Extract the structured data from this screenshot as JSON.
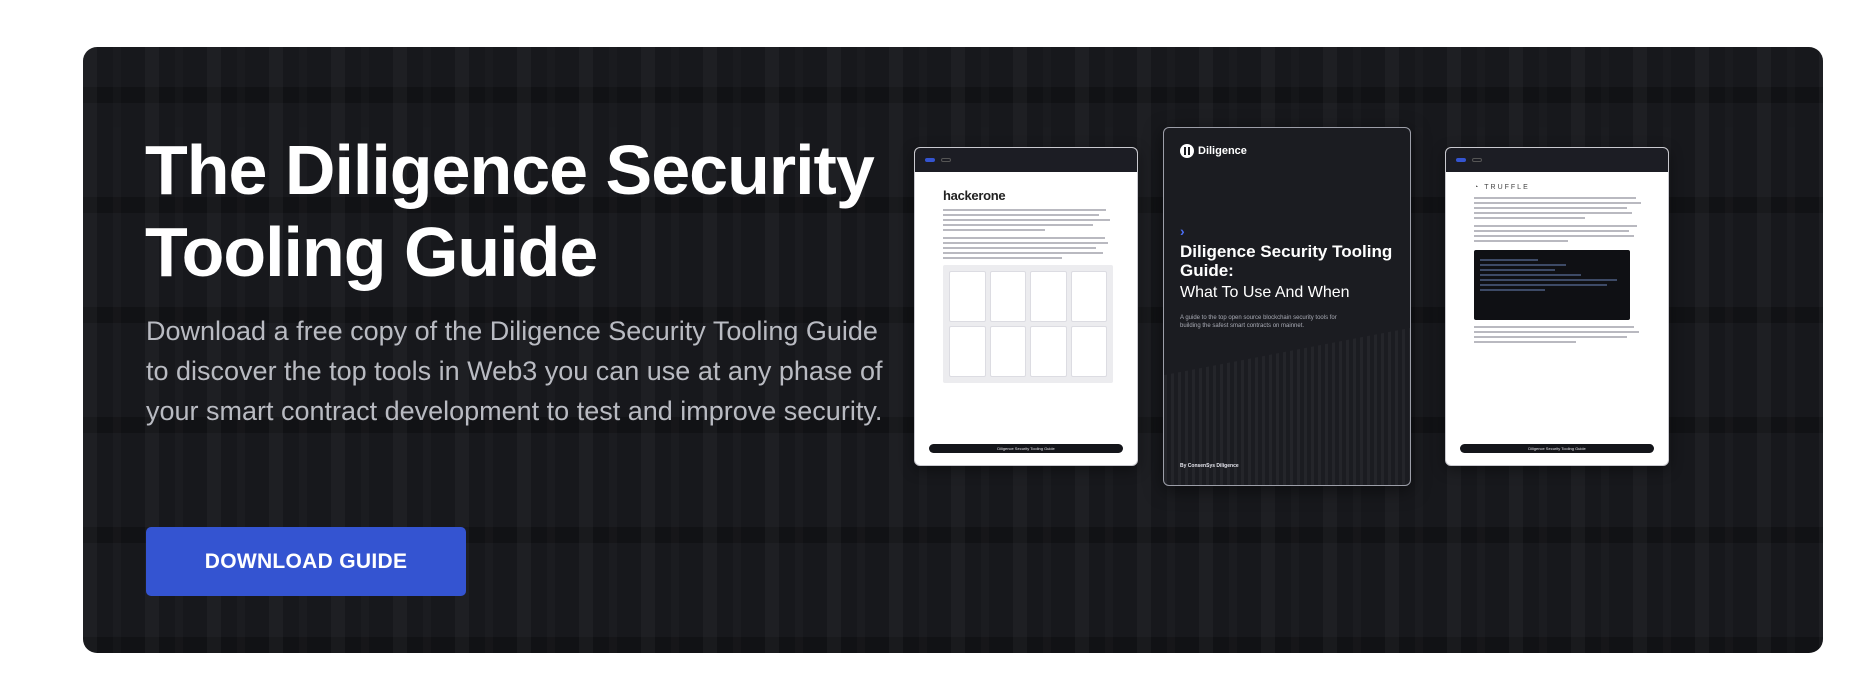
{
  "hero": {
    "title": "The Diligence Security Tooling Guide",
    "description": "Download a free copy of the Diligence Security Tooling Guide to discover the top tools in Web3 you can use at any phase of your smart contract development to test and improve security.",
    "cta_label": "DOWNLOAD GUIDE"
  },
  "colors": {
    "background": "#17181c",
    "accent": "#3454d1",
    "text": "#ffffff",
    "muted": "#b9bbc2"
  },
  "guide_pages": {
    "left": {
      "brand": "hackerone",
      "footer": "Diligence Security Tooling Guide"
    },
    "center": {
      "brand": "Diligence",
      "title": "Diligence Security Tooling Guide:",
      "subtitle": "What To Use And When",
      "description": "A guide to the top open source blockchain security tools for building the safest smart contracts on mainnet.",
      "byline": "By ConsenSys Diligence"
    },
    "right": {
      "brand": "TRUFFLE",
      "footer": "Diligence Security Tooling Guide"
    }
  }
}
